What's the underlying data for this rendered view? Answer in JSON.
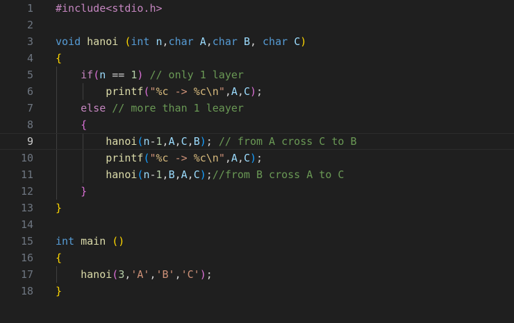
{
  "colors": {
    "background": "#1f1f1f",
    "line_number": "#6e7681",
    "line_number_active": "#cccccc",
    "keyword": "#569cd6",
    "directive": "#c586c0",
    "function": "#dcdcaa",
    "parameter": "#9cdcfe",
    "string": "#ce9178",
    "escape": "#d7ba7d",
    "number": "#b5cea8",
    "comment": "#6a9955",
    "plain": "#d4d4d4",
    "bracket_level1": "#ffd700",
    "bracket_level2": "#da70d6",
    "bracket_level3": "#179fff"
  },
  "editor": {
    "language": "c",
    "active_line": 9,
    "lines": [
      {
        "number": "1",
        "tokens": [
          {
            "t": "directive",
            "v": "#include<stdio.h>"
          }
        ]
      },
      {
        "number": "2",
        "tokens": []
      },
      {
        "number": "3",
        "tokens": [
          {
            "t": "keyword",
            "v": "void"
          },
          {
            "t": "plain",
            "v": " "
          },
          {
            "t": "func",
            "v": "hanoi"
          },
          {
            "t": "plain",
            "v": " "
          },
          {
            "t": "brace1",
            "v": "("
          },
          {
            "t": "keyword",
            "v": "int"
          },
          {
            "t": "plain",
            "v": " "
          },
          {
            "t": "param",
            "v": "n"
          },
          {
            "t": "plain",
            "v": ","
          },
          {
            "t": "keyword",
            "v": "char"
          },
          {
            "t": "plain",
            "v": " "
          },
          {
            "t": "param",
            "v": "A"
          },
          {
            "t": "plain",
            "v": ","
          },
          {
            "t": "keyword",
            "v": "char"
          },
          {
            "t": "plain",
            "v": " "
          },
          {
            "t": "param",
            "v": "B"
          },
          {
            "t": "plain",
            "v": ", "
          },
          {
            "t": "keyword",
            "v": "char"
          },
          {
            "t": "plain",
            "v": " "
          },
          {
            "t": "param",
            "v": "C"
          },
          {
            "t": "brace1",
            "v": ")"
          }
        ]
      },
      {
        "number": "4",
        "tokens": [
          {
            "t": "brace1",
            "v": "{"
          }
        ]
      },
      {
        "number": "5",
        "tokens": [
          {
            "t": "plain",
            "v": "    "
          },
          {
            "t": "directive",
            "v": "if"
          },
          {
            "t": "brace2",
            "v": "("
          },
          {
            "t": "param",
            "v": "n"
          },
          {
            "t": "plain",
            "v": " == "
          },
          {
            "t": "number",
            "v": "1"
          },
          {
            "t": "brace2",
            "v": ")"
          },
          {
            "t": "plain",
            "v": " "
          },
          {
            "t": "comment",
            "v": "// only 1 layer"
          }
        ]
      },
      {
        "number": "6",
        "tokens": [
          {
            "t": "plain",
            "v": "        "
          },
          {
            "t": "func",
            "v": "printf"
          },
          {
            "t": "brace2",
            "v": "("
          },
          {
            "t": "string",
            "v": "\""
          },
          {
            "t": "escape",
            "v": "%c"
          },
          {
            "t": "string",
            "v": " -> "
          },
          {
            "t": "escape",
            "v": "%c\\n"
          },
          {
            "t": "string",
            "v": "\""
          },
          {
            "t": "plain",
            "v": ","
          },
          {
            "t": "param",
            "v": "A"
          },
          {
            "t": "plain",
            "v": ","
          },
          {
            "t": "param",
            "v": "C"
          },
          {
            "t": "brace2",
            "v": ")"
          },
          {
            "t": "plain",
            "v": ";"
          }
        ]
      },
      {
        "number": "7",
        "tokens": [
          {
            "t": "plain",
            "v": "    "
          },
          {
            "t": "directive",
            "v": "else"
          },
          {
            "t": "plain",
            "v": " "
          },
          {
            "t": "comment",
            "v": "// more than 1 leayer"
          }
        ]
      },
      {
        "number": "8",
        "tokens": [
          {
            "t": "plain",
            "v": "    "
          },
          {
            "t": "brace2",
            "v": "{"
          }
        ]
      },
      {
        "number": "9",
        "tokens": [
          {
            "t": "plain",
            "v": "        "
          },
          {
            "t": "func",
            "v": "hanoi"
          },
          {
            "t": "brace3",
            "v": "("
          },
          {
            "t": "param",
            "v": "n"
          },
          {
            "t": "plain",
            "v": "-"
          },
          {
            "t": "number",
            "v": "1"
          },
          {
            "t": "plain",
            "v": ","
          },
          {
            "t": "param",
            "v": "A"
          },
          {
            "t": "plain",
            "v": ","
          },
          {
            "t": "param",
            "v": "C"
          },
          {
            "t": "plain",
            "v": ","
          },
          {
            "t": "param",
            "v": "B"
          },
          {
            "t": "brace3",
            "v": ")"
          },
          {
            "t": "plain",
            "v": "; "
          },
          {
            "t": "comment",
            "v": "// from A cross C to B"
          }
        ]
      },
      {
        "number": "10",
        "tokens": [
          {
            "t": "plain",
            "v": "        "
          },
          {
            "t": "func",
            "v": "printf"
          },
          {
            "t": "brace3",
            "v": "("
          },
          {
            "t": "string",
            "v": "\""
          },
          {
            "t": "escape",
            "v": "%c"
          },
          {
            "t": "string",
            "v": " -> "
          },
          {
            "t": "escape",
            "v": "%c\\n"
          },
          {
            "t": "string",
            "v": "\""
          },
          {
            "t": "plain",
            "v": ","
          },
          {
            "t": "param",
            "v": "A"
          },
          {
            "t": "plain",
            "v": ","
          },
          {
            "t": "param",
            "v": "C"
          },
          {
            "t": "brace3",
            "v": ")"
          },
          {
            "t": "plain",
            "v": ";"
          }
        ]
      },
      {
        "number": "11",
        "tokens": [
          {
            "t": "plain",
            "v": "        "
          },
          {
            "t": "func",
            "v": "hanoi"
          },
          {
            "t": "brace3",
            "v": "("
          },
          {
            "t": "param",
            "v": "n"
          },
          {
            "t": "plain",
            "v": "-"
          },
          {
            "t": "number",
            "v": "1"
          },
          {
            "t": "plain",
            "v": ","
          },
          {
            "t": "param",
            "v": "B"
          },
          {
            "t": "plain",
            "v": ","
          },
          {
            "t": "param",
            "v": "A"
          },
          {
            "t": "plain",
            "v": ","
          },
          {
            "t": "param",
            "v": "C"
          },
          {
            "t": "brace3",
            "v": ")"
          },
          {
            "t": "plain",
            "v": ";"
          },
          {
            "t": "comment",
            "v": "//from B cross A to C"
          }
        ]
      },
      {
        "number": "12",
        "tokens": [
          {
            "t": "plain",
            "v": "    "
          },
          {
            "t": "brace2",
            "v": "}"
          }
        ]
      },
      {
        "number": "13",
        "tokens": [
          {
            "t": "brace1",
            "v": "}"
          }
        ]
      },
      {
        "number": "14",
        "tokens": []
      },
      {
        "number": "15",
        "tokens": [
          {
            "t": "keyword",
            "v": "int"
          },
          {
            "t": "plain",
            "v": " "
          },
          {
            "t": "func",
            "v": "main"
          },
          {
            "t": "plain",
            "v": " "
          },
          {
            "t": "brace1",
            "v": "()"
          }
        ]
      },
      {
        "number": "16",
        "tokens": [
          {
            "t": "brace1",
            "v": "{"
          }
        ]
      },
      {
        "number": "17",
        "tokens": [
          {
            "t": "plain",
            "v": "    "
          },
          {
            "t": "func",
            "v": "hanoi"
          },
          {
            "t": "brace2",
            "v": "("
          },
          {
            "t": "number",
            "v": "3"
          },
          {
            "t": "plain",
            "v": ","
          },
          {
            "t": "string",
            "v": "'A'"
          },
          {
            "t": "plain",
            "v": ","
          },
          {
            "t": "string",
            "v": "'B'"
          },
          {
            "t": "plain",
            "v": ","
          },
          {
            "t": "string",
            "v": "'C'"
          },
          {
            "t": "brace2",
            "v": ")"
          },
          {
            "t": "plain",
            "v": ";"
          }
        ]
      },
      {
        "number": "18",
        "tokens": [
          {
            "t": "brace1",
            "v": "}"
          }
        ]
      }
    ]
  }
}
